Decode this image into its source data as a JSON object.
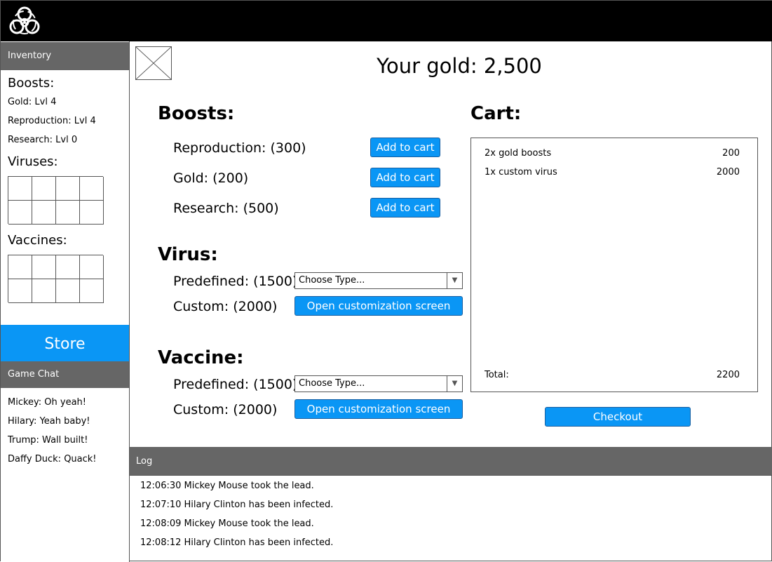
{
  "inventory": {
    "title": "Inventory",
    "boosts_heading": "Boosts:",
    "boosts": [
      "Gold: Lvl 4",
      "Reproduction: Lvl 4",
      "Research: Lvl 0"
    ],
    "viruses_heading": "Viruses:",
    "vaccines_heading": "Vaccines:"
  },
  "nav": {
    "store_label": "Store"
  },
  "chat": {
    "title": "Game Chat",
    "messages": [
      "Mickey: Oh yeah!",
      "Hilary: Yeah baby!",
      "Trump: Wall built!",
      "Daffy Duck: Quack!"
    ]
  },
  "store": {
    "gold_text": "Your gold: 2,500",
    "boosts_title": "Boosts:",
    "boost_items": [
      {
        "label": "Reproduction: (300)",
        "button": "Add to cart"
      },
      {
        "label": "Gold: (200)",
        "button": "Add to cart"
      },
      {
        "label": "Research: (500)",
        "button": "Add to cart"
      }
    ],
    "virus_title": "Virus:",
    "virus": {
      "predefined_label": "Predefined: (1500)",
      "select_value": "Choose Type...",
      "custom_label": "Custom: (2000)",
      "custom_button": "Open customization screen"
    },
    "vaccine_title": "Vaccine:",
    "vaccine": {
      "predefined_label": "Predefined: (1500)",
      "select_value": "Choose Type...",
      "custom_label": "Custom: (2000)",
      "custom_button": "Open customization screen"
    }
  },
  "cart": {
    "title": "Cart:",
    "items": [
      {
        "name": "2x gold boosts",
        "amount": "200"
      },
      {
        "name": "1x custom virus",
        "amount": "2000"
      }
    ],
    "total_label": "Total:",
    "total_value": "2200",
    "checkout_label": "Checkout"
  },
  "log": {
    "title": "Log",
    "entries": [
      "12:06:30 Mickey Mouse took the lead.",
      "12:07:10  Hilary Clinton has been infected.",
      "12:08:09 Mickey Mouse took the lead.",
      "12:08:12 Hilary Clinton has been infected."
    ]
  },
  "colors": {
    "accent": "#0a96f5",
    "header_bg": "#666666",
    "topbar_bg": "#000000"
  },
  "icons": {
    "logo": "biohazard-icon",
    "dropdown": "chevron-down-icon",
    "placeholder": "image-placeholder-icon"
  }
}
